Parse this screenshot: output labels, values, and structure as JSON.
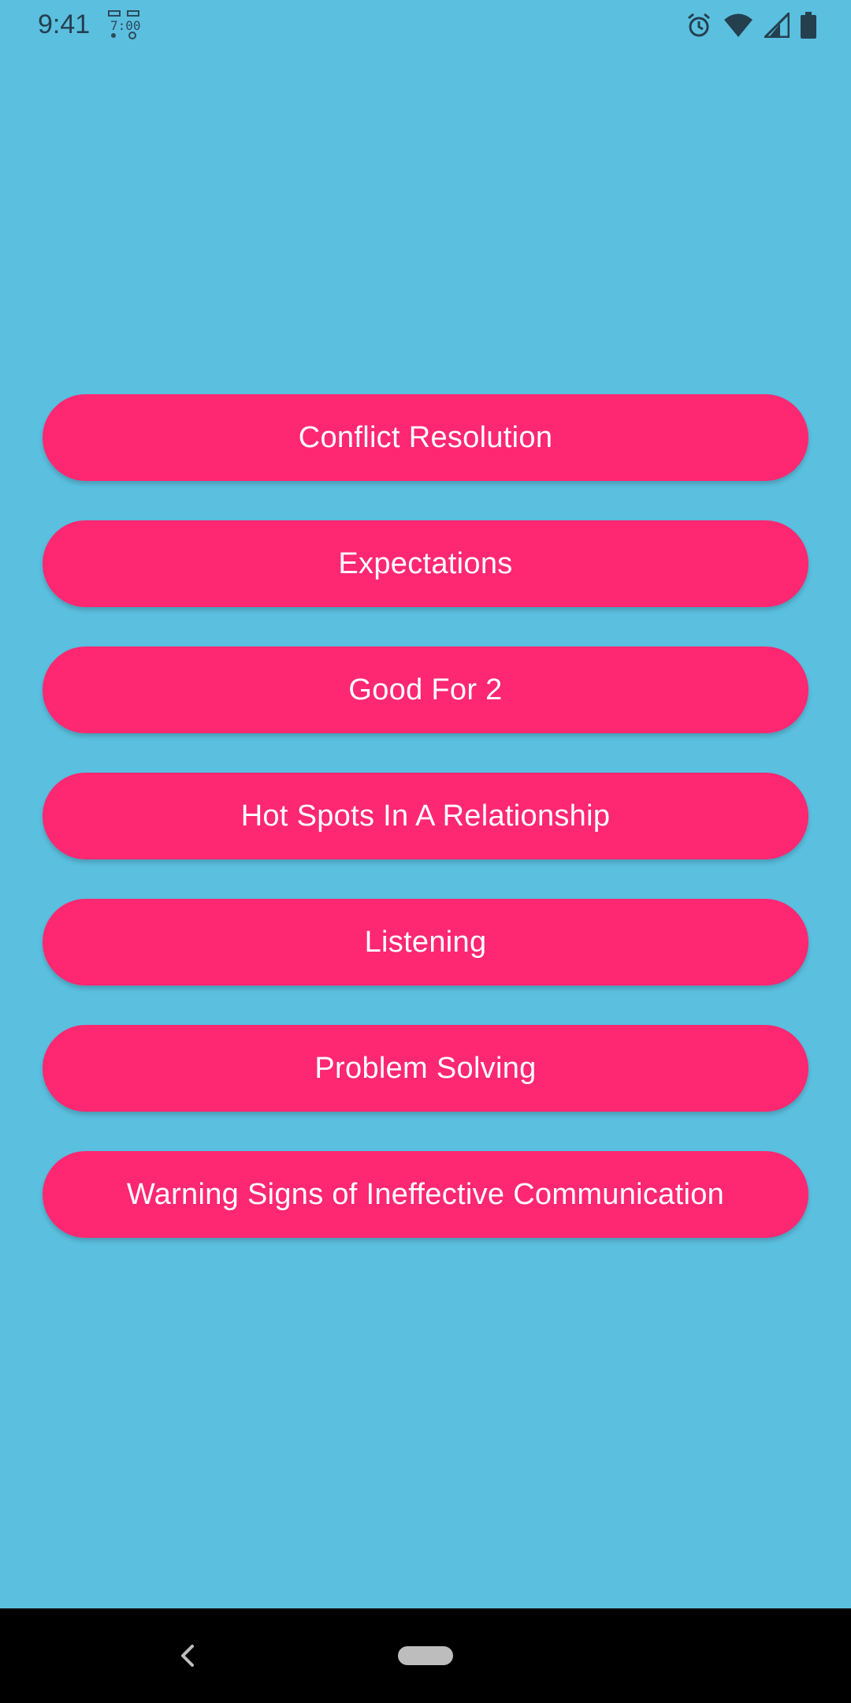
{
  "status_bar": {
    "time": "9:41",
    "icons": [
      "app-notification-icon",
      "alarm-icon",
      "wifi-icon",
      "signal-icon",
      "battery-icon"
    ]
  },
  "menu": {
    "items": [
      {
        "label": "Conflict Resolution"
      },
      {
        "label": "Expectations"
      },
      {
        "label": "Good For 2"
      },
      {
        "label": "Hot Spots In A Relationship"
      },
      {
        "label": "Listening"
      },
      {
        "label": "Problem Solving"
      },
      {
        "label": "Warning Signs of Ineffective Communication"
      }
    ]
  },
  "nav_bar": {
    "icons": [
      "back-icon",
      "home-pill-icon"
    ]
  },
  "colors": {
    "background": "#5bbfdf",
    "button": "#fe2771",
    "button_text": "#ffffff",
    "nav_bar": "#000000"
  }
}
